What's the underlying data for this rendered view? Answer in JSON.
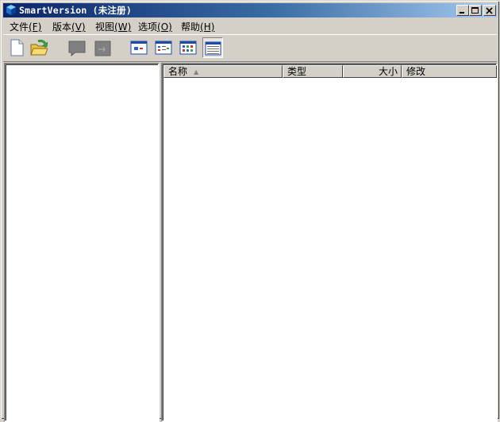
{
  "window": {
    "title": "SmartVersion (未注册)"
  },
  "menu": [
    {
      "label": "文件",
      "accel": "(F)"
    },
    {
      "label": "版本",
      "accel": "(V)"
    },
    {
      "label": "视图",
      "accel": "(W)"
    },
    {
      "label": "选项",
      "accel": "(O)"
    },
    {
      "label": "帮助",
      "accel": "(H)"
    }
  ],
  "toolbar": {
    "icons": [
      "new-file-icon",
      "open-folder-icon",
      "back-icon",
      "forward-icon",
      "large-icons-view-icon",
      "small-icons-view-icon",
      "list-view-icon",
      "details-view-icon"
    ],
    "active_view": "details"
  },
  "file_list": {
    "columns": [
      {
        "label": "名称",
        "sorted": "ascending"
      },
      {
        "label": "类型"
      },
      {
        "label": "大小"
      },
      {
        "label": "修改"
      }
    ],
    "rows": []
  },
  "colors": {
    "title_start": "#0a246a",
    "title_end": "#a6caf0",
    "face": "#d4d0c8"
  }
}
